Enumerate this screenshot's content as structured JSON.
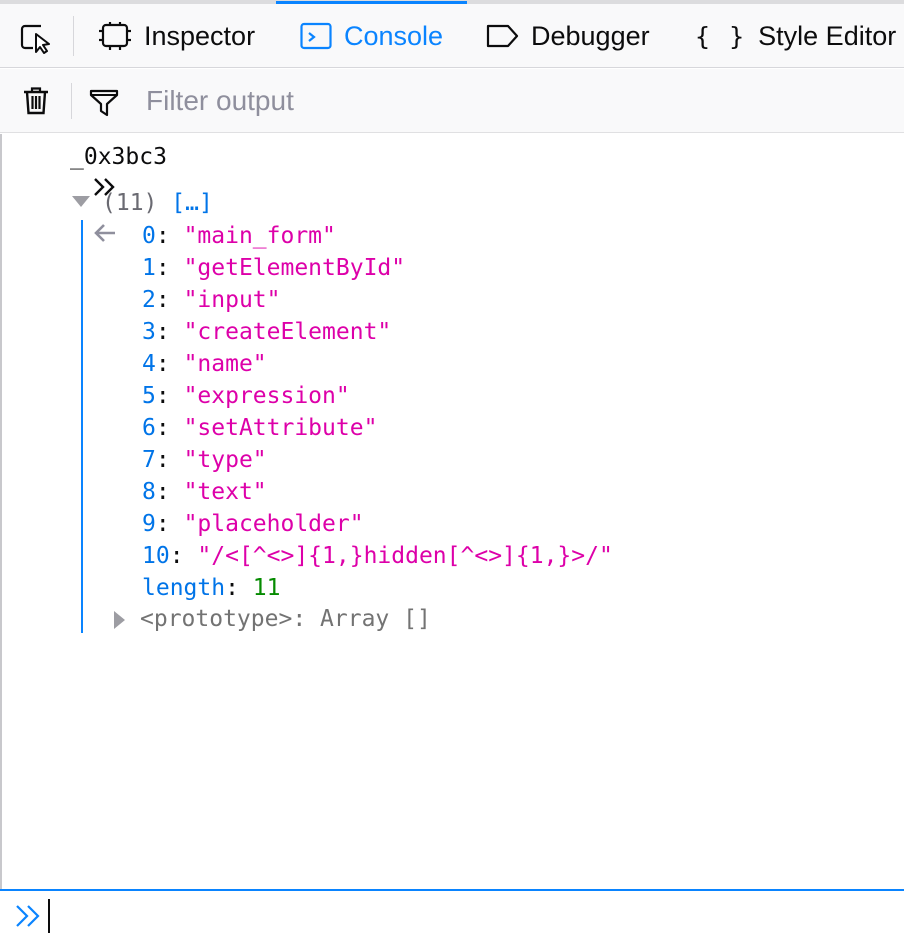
{
  "toolbar": {
    "tabs": [
      {
        "label": "Inspector",
        "icon": "inspector-icon"
      },
      {
        "label": "Console",
        "icon": "console-icon"
      },
      {
        "label": "Debugger",
        "icon": "debugger-icon"
      },
      {
        "label": "Style Editor",
        "icon": "style-editor-icon"
      }
    ],
    "active_tab": "Console",
    "braces_glyph": "{ }",
    "accent_color": "#0a84ff"
  },
  "filter": {
    "placeholder": "Filter output",
    "value": ""
  },
  "console": {
    "command": "_0x3bc3",
    "result_count": "(11)",
    "result_preview": "[…]",
    "items": [
      {
        "index": "0",
        "value": "\"main_form\""
      },
      {
        "index": "1",
        "value": "\"getElementById\""
      },
      {
        "index": "2",
        "value": "\"input\""
      },
      {
        "index": "3",
        "value": "\"createElement\""
      },
      {
        "index": "4",
        "value": "\"name\""
      },
      {
        "index": "5",
        "value": "\"expression\""
      },
      {
        "index": "6",
        "value": "\"setAttribute\""
      },
      {
        "index": "7",
        "value": "\"type\""
      },
      {
        "index": "8",
        "value": "\"text\""
      },
      {
        "index": "9",
        "value": "\"placeholder\""
      },
      {
        "index": "10",
        "value": "\"/<[^<>]{1,}hidden[^<>]{1,}>/\""
      }
    ],
    "length_label": "length",
    "length_value": "11",
    "prototype_label": "<prototype>",
    "prototype_value": "Array []",
    "colors": {
      "index": "#0074e8",
      "string": "#dd00a9",
      "number": "#058b00"
    }
  },
  "input": {
    "value": ""
  }
}
